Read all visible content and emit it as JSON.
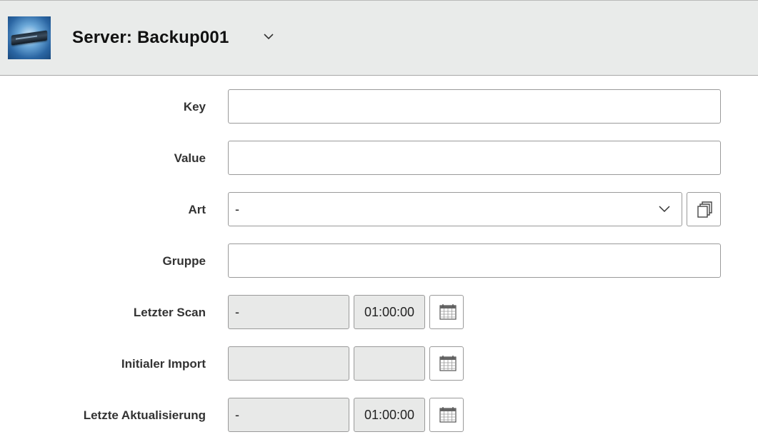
{
  "header": {
    "title": "Server: Backup001",
    "icon": "server-icon",
    "dropdown_icon": "chevron-down-icon"
  },
  "form": {
    "key": {
      "label": "Key",
      "value": ""
    },
    "value": {
      "label": "Value",
      "value": ""
    },
    "art": {
      "label": "Art",
      "selected": "-",
      "action_icon": "copy-icon"
    },
    "gruppe": {
      "label": "Gruppe",
      "value": ""
    },
    "letzter_scan": {
      "label": "Letzter Scan",
      "date": "-",
      "time": "01:00:00",
      "icon": "calendar-icon"
    },
    "initialer_import": {
      "label": "Initialer Import",
      "date": "",
      "time": "",
      "icon": "calendar-icon"
    },
    "letzte_aktualisierung": {
      "label": "Letzte Aktualisierung",
      "date": "-",
      "time": "01:00:00",
      "icon": "calendar-icon"
    }
  },
  "colors": {
    "header_bg": "#e9ebea",
    "disabled_bg": "#e8e9e8",
    "border": "#9a9a9a"
  }
}
